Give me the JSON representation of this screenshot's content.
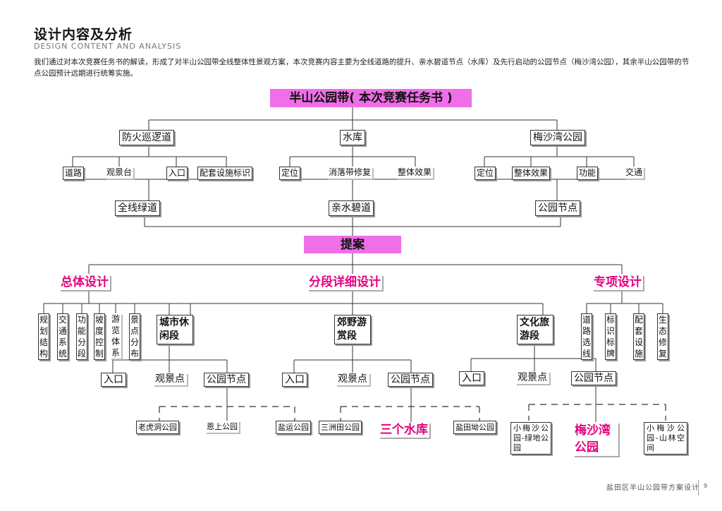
{
  "header": {
    "title": "设计内容及分析",
    "subtitle": "DESIGN CONTENT AND ANALYSIS",
    "intro": "我们通过对本次竞赛任务书的解读，形成了对半山公园带全线整体性景观方案，本次竞赛内容主要为全线道路的提升、亲水碧道节点（水库）及先行启动的公园节点（梅沙湾公园），其余半山公园带的节点公园预计远期进行统筹实施。"
  },
  "tree": {
    "root": "半山公园带( 本次竞赛任务书 )",
    "branches": [
      {
        "label": "防火巡逻道",
        "items": [
          "道路",
          "观景台",
          "入口",
          "配套设施标识"
        ],
        "result": "全线绿道"
      },
      {
        "label": "水库",
        "items": [
          "定位",
          "消落带修复",
          "整体效果"
        ],
        "result": "亲水碧道"
      },
      {
        "label": "梅沙湾公园",
        "items": [
          "定位",
          "整体效果",
          "功能",
          "交通"
        ],
        "result": "公园节点"
      }
    ],
    "proposal": "提案",
    "categories": {
      "overall": {
        "label": "总体设计",
        "items": [
          "规划结构",
          "交通系统",
          "功能分段",
          "坡度控制",
          "游览体系",
          "景点分布"
        ]
      },
      "sections": {
        "label": "分段详细设计",
        "segments": [
          {
            "label": "城市休闲段",
            "children": [
              "入口",
              "观景点",
              "公园节点"
            ],
            "parks": [
              "老虎洞公园",
              "恩上公园",
              "盐运公园"
            ]
          },
          {
            "label": "郊野游赏段",
            "children": [
              "入口",
              "观景点",
              "公园节点"
            ],
            "parks": [
              "三洲田公园",
              "三个水库",
              "盐田坳公园"
            ]
          },
          {
            "label": "文化旅游段",
            "children": [
              "入口",
              "观景点",
              "公园节点"
            ],
            "parks": [
              "小梅沙公园-绿地公园",
              "梅沙湾公园",
              "小梅沙公园-山林空间"
            ]
          }
        ]
      },
      "special": {
        "label": "专项设计",
        "items": [
          "道路选线",
          "标识标牌",
          "配套设施",
          "生态修复"
        ]
      }
    }
  },
  "footer": {
    "project": "盐田区半山公园带方案设计",
    "page": "9"
  }
}
